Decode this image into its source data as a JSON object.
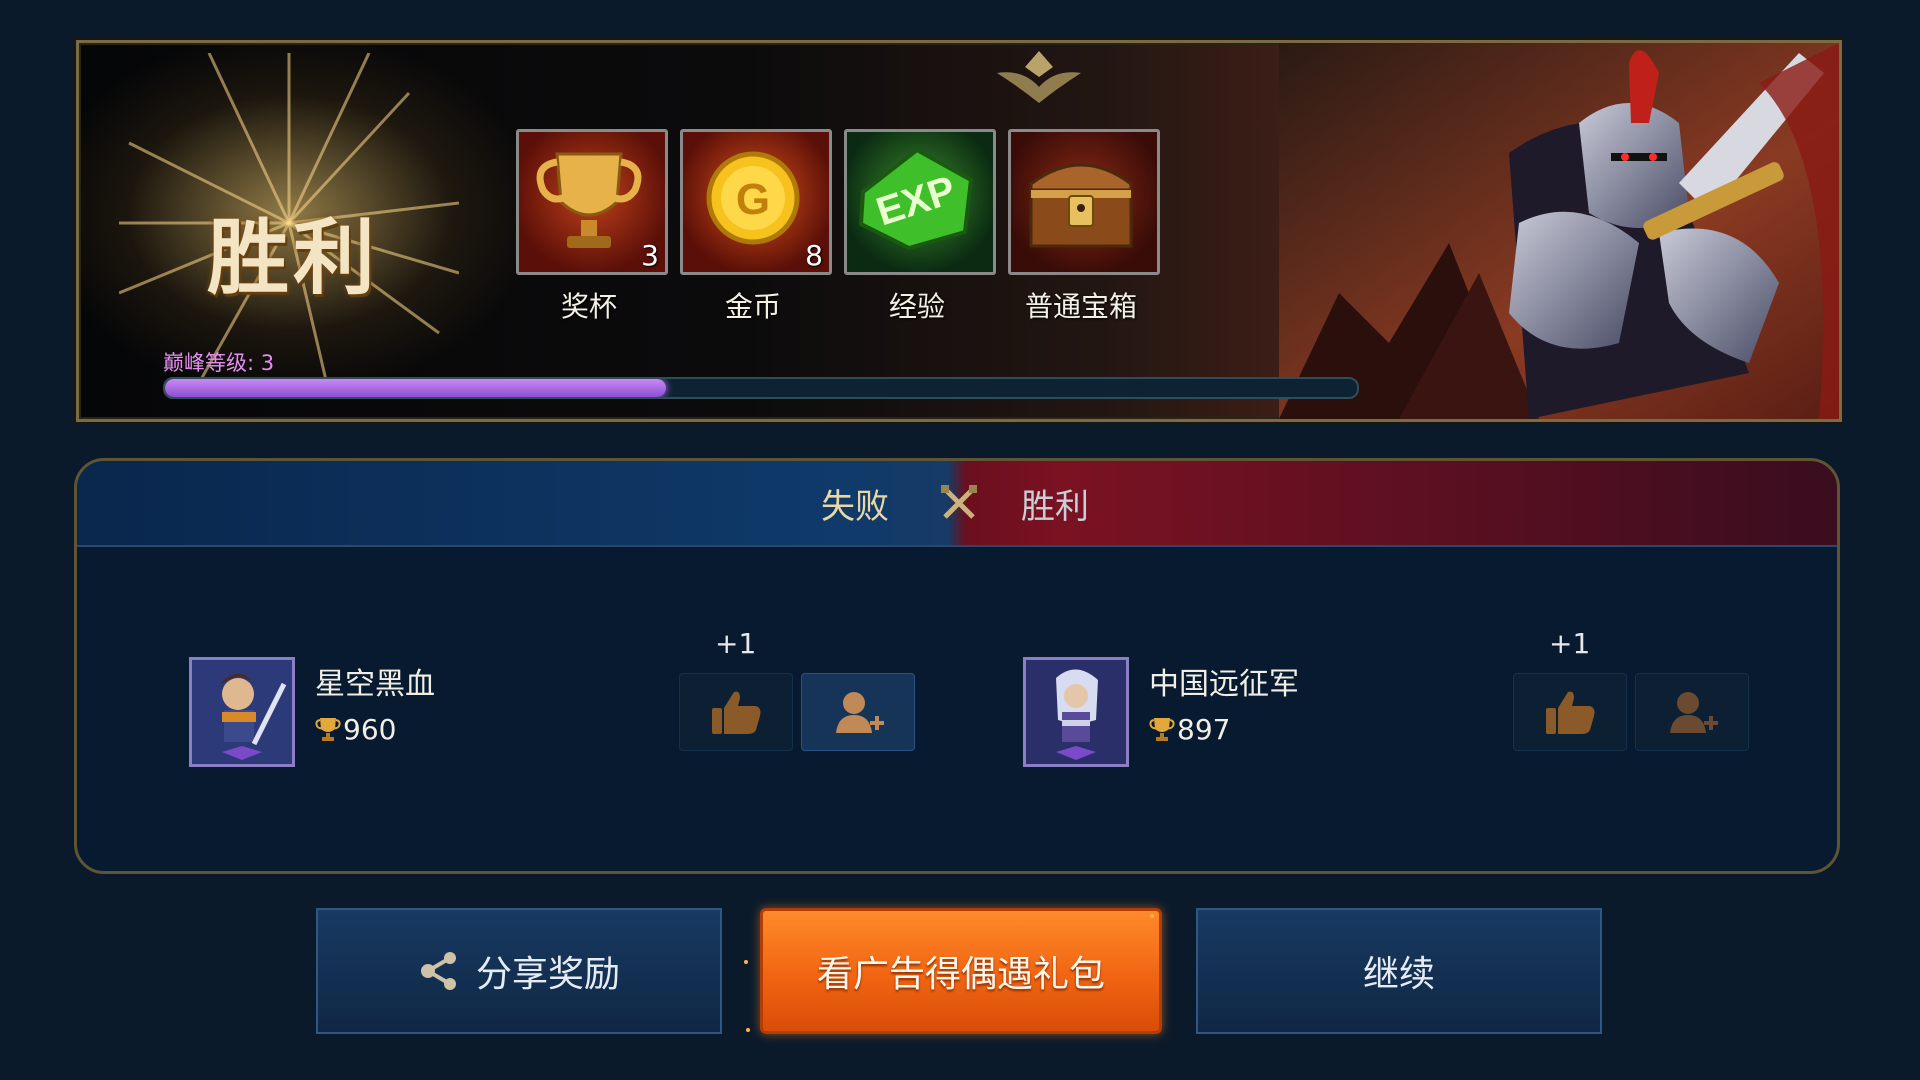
{
  "result_banner": {
    "title": "胜利",
    "rewards": [
      {
        "label": "奖杯",
        "icon": "trophy-icon",
        "quantity": "3"
      },
      {
        "label": "金币",
        "icon": "gold-coin-icon",
        "quantity": "8"
      },
      {
        "label": "经验",
        "icon": "exp-icon",
        "quantity": ""
      },
      {
        "label": "普通宝箱",
        "icon": "treasure-chest-icon",
        "quantity": ""
      }
    ],
    "level": {
      "label": "巅峰等级: 3",
      "progress": 0.42
    }
  },
  "match": {
    "left_team_label": "失败",
    "right_team_label": "胜利",
    "players": [
      {
        "name": "星空黑血",
        "score": "960",
        "likes": "+1"
      },
      {
        "name": "中国远征军",
        "score": "897",
        "likes": "+1"
      }
    ]
  },
  "actions": {
    "share_label": "分享奖励",
    "ad_label": "看广告得偶遇礼包",
    "continue_label": "继续"
  },
  "colors": {
    "accent_orange": "#f06412",
    "level_purple": "#b773ff",
    "panel_blue": "#071a30"
  }
}
